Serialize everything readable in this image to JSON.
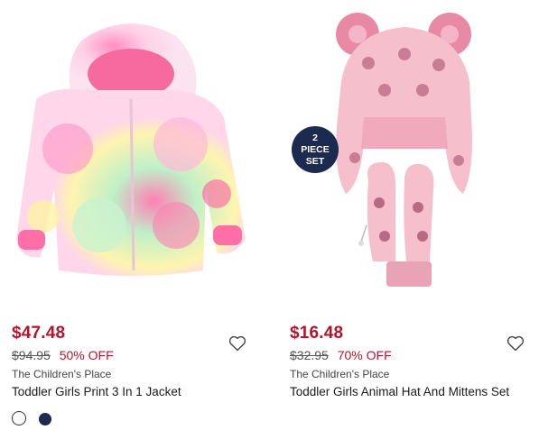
{
  "products": [
    {
      "price": "$47.48",
      "old_price": "$94.95",
      "discount": "50% OFF",
      "brand": "The Children's Place",
      "name": "Toddler Girls Print 3 In 1 Jacket",
      "image": "tie-dye-jacket"
    },
    {
      "price": "$16.48",
      "old_price": "$32.95",
      "discount": "70% OFF",
      "brand": "The Children's Place",
      "name": "Toddler Girls Animal Hat And Mittens Set",
      "image": "hat-and-mittens",
      "badge_line1": "2",
      "badge_line2": "PIECE",
      "badge_line3": "SET"
    }
  ],
  "colors": {
    "price_red": "#b4152b",
    "badge_navy": "#1b2a4e"
  },
  "icons": [
    "heart-icon"
  ]
}
